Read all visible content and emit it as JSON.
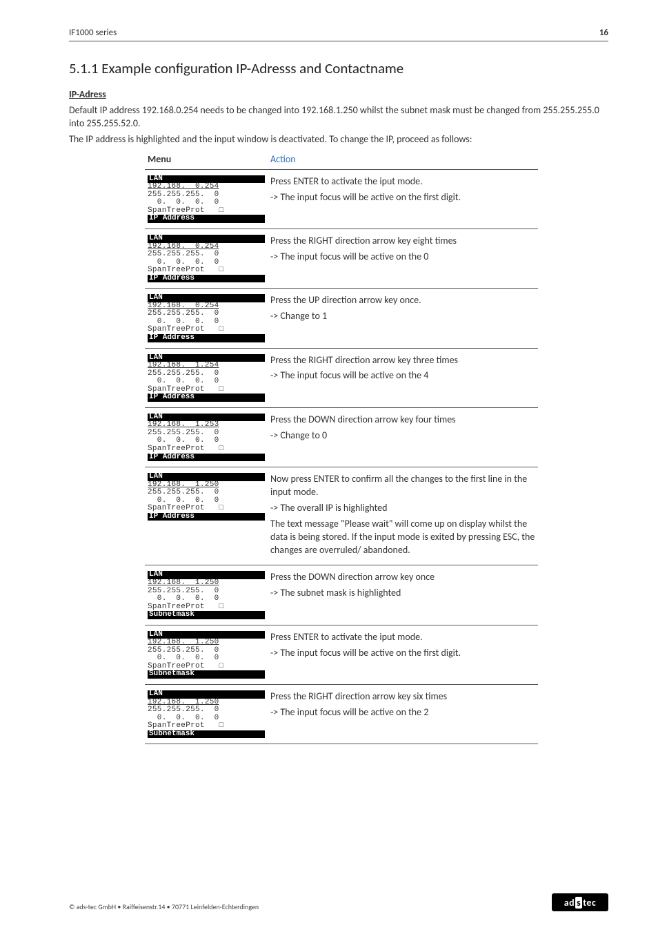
{
  "header": {
    "series": "IF1000 series",
    "page_num": "16"
  },
  "section_title": "5.1.1  Example configuration IP-Adresss and Contactname",
  "subheading": "IP-Adress",
  "intro_line1": "Default IP address 192.168.0.254 needs to be changed into 192.168.1.250 whilst the subnet mask must be changed from 255.255.255.0 into 255.255.52.0.",
  "intro_line2": "The IP address is highlighted and the input window is deactivated. To change the IP, proceed as follows:",
  "table": {
    "head_menu": "Menu",
    "head_action": "Action",
    "rows": [
      {
        "action_lines": [
          "Press ENTER to activate the iput mode.",
          "-> The input focus will be active on the first digit."
        ],
        "lcd": {
          "top_bar": "LAN",
          "l1": "192.168.  0.254",
          "l2": "255.255.255.  0",
          "l3": "  0.  0.  0.  0",
          "l4": "SpanTreeProt   □",
          "bot_bar": "IP Address"
        }
      },
      {
        "action_lines": [
          "Press the RIGHT direction arrow key eight times",
          "-> The input focus will be active on the 0"
        ],
        "lcd": {
          "top_bar": "LAN",
          "l1": "192.168.  0.254",
          "l2": "255.255.255.  0",
          "l3": "  0.  0.  0.  0",
          "l4": "SpanTreeProt   □",
          "bot_bar": "IP Address"
        }
      },
      {
        "action_lines": [
          "Press the UP direction arrow key once.",
          "-> Change to 1"
        ],
        "lcd": {
          "top_bar": "LAN",
          "l1": "192.168.  0.254",
          "l2": "255.255.255.  0",
          "l3": "  0.  0.  0.  0",
          "l4": "SpanTreeProt   □",
          "bot_bar": "IP Address"
        }
      },
      {
        "action_lines": [
          "Press the RIGHT direction arrow key three times",
          "-> The input focus will be active on the 4"
        ],
        "lcd": {
          "top_bar": "LAN",
          "l1": "192.168.  1.254",
          "l2": "255.255.255.  0",
          "l3": "  0.  0.  0.  0",
          "l4": "SpanTreeProt   □",
          "bot_bar": "IP Address"
        }
      },
      {
        "action_lines": [
          "Press the DOWN direction arrow key four times",
          "-> Change to 0"
        ],
        "lcd": {
          "top_bar": "LAN",
          "l1": "192.168.  1.253",
          "l2": "255.255.255.  0",
          "l3": "  0.  0.  0.  0",
          "l4": "SpanTreeProt   □",
          "bot_bar": "IP Address"
        }
      },
      {
        "action_lines": [
          "Now press ENTER to confirm all the changes to the first line in the input mode.",
          "-> The overall IP is highlighted",
          "The text message \"Please wait\" will come up on display whilst the data is being stored. If the input mode is exited by pressing ESC, the changes are overruled/ abandoned."
        ],
        "lcd": {
          "top_bar": "LAN",
          "l1": "192.168.  1.250",
          "l2": "255.255.255.  0",
          "l3": "  0.  0.  0.  0",
          "l4": "SpanTreeProt   □",
          "bot_bar": "IP Address"
        }
      },
      {
        "action_lines": [
          "Press the DOWN direction arrow key once",
          "-> The subnet mask is highlighted"
        ],
        "lcd": {
          "top_bar": "LAN",
          "l1": "192.168.  1.250",
          "l2": "255.255.255.  0",
          "l3": "  0.  0.  0.  0",
          "l4": "SpanTreeProt   □",
          "bot_bar": "Subnetmask"
        }
      },
      {
        "action_lines": [
          "Press ENTER to activate the iput mode.",
          "-> The input focus will be active on the first digit."
        ],
        "lcd": {
          "top_bar": "LAN",
          "l1": "192.168.  1.250",
          "l2": "255.255.255.  0",
          "l3": "  0.  0.  0.  0",
          "l4": "SpanTreeProt   □",
          "bot_bar": "Subnetmask"
        }
      },
      {
        "action_lines": [
          "Press the RIGHT direction arrow key six times",
          "-> The input focus will be active on the 2"
        ],
        "lcd": {
          "top_bar": "LAN",
          "l1": "192.168.  1.250",
          "l2": "255.255.255.  0",
          "l3": "  0.  0.  0.  0",
          "l4": "SpanTreeProt   □",
          "bot_bar": "Subnetmask"
        }
      }
    ]
  },
  "footer": {
    "copyright": "© ads-tec GmbH • Raiffeisenstr.14 • 70771 Leinfelden-Echterdingen",
    "logo_left": "ad",
    "logo_s": "s",
    "logo_right": "tec"
  }
}
